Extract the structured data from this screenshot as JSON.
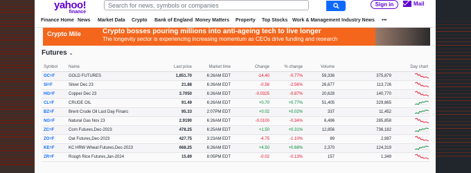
{
  "header": {
    "logo": "yahoo!",
    "logo_sub": "finance",
    "search_placeholder": "Search for news, symbols or companies",
    "signin": "Sign in",
    "mail": "Mail"
  },
  "nav": [
    "Finance Home",
    "News",
    "Market Data",
    "Crypto",
    "Bank of England",
    "Money Matters",
    "Property",
    "Top Stocks",
    "Work & Management",
    "Industry News",
    "•••"
  ],
  "banner": {
    "tag": "Crypto Mile",
    "headline": "Crypto bosses pouring millions into anti-ageing tech to live longer",
    "subline": "The longevity sector is experiencing increasing momentum as CEOs drive funding and research"
  },
  "section": {
    "title": "Futures"
  },
  "table": {
    "headers": [
      "Symbol",
      "Name",
      "Last price",
      "Market time",
      "Change",
      "% change",
      "Volume",
      "",
      "Day chart"
    ],
    "rows": [
      {
        "symbol": "GC=F",
        "name": "GOLD FUTURES",
        "price": "1,851.70",
        "time": "6:26AM EDT",
        "change": "-14.40",
        "pct": "-0.77%",
        "volume": "59,336",
        "oi": "375,879",
        "dir": "neg"
      },
      {
        "symbol": "SI=F",
        "name": "Silver Dec 23",
        "price": "21.88",
        "time": "6:26AM EDT",
        "change": "-0.58",
        "pct": "-2.56%",
        "volume": "26,677",
        "oi": "113,726",
        "dir": "neg"
      },
      {
        "symbol": "HG=F",
        "name": "Copper Dec 23",
        "price": "3.7050",
        "time": "6:26AM EDT",
        "change": "-0.0325",
        "pct": "-0.87%",
        "volume": "20,628",
        "oi": "140,770",
        "dir": "neg"
      },
      {
        "symbol": "CL=F",
        "name": "CRUDE OIL",
        "price": "91.49",
        "time": "6:26AM EDT",
        "change": "+0.70",
        "pct": "+0.77%",
        "volume": "51,405",
        "oi": "329,865",
        "dir": "pos"
      },
      {
        "symbol": "BZ=F",
        "name": "Brent Crude Oil Last Day Financ",
        "price": "95.33",
        "time": "2:07PM EDT",
        "change": "+0.02",
        "pct": "+0.02%",
        "volume": "337",
        "oi": "11,452",
        "dir": "pos"
      },
      {
        "symbol": "NG=F",
        "name": "Natural Gas Nov 23",
        "price": "2.9190",
        "time": "6:26AM EDT",
        "change": "-0.0100",
        "pct": "-0.34%",
        "volume": "6,496",
        "oi": "285,858",
        "dir": "neg"
      },
      {
        "symbol": "ZC=F",
        "name": "Corn Futures,Dec-2023",
        "price": "478.25",
        "time": "6:25AM EDT",
        "change": "+1.50",
        "pct": "+0.31%",
        "volume": "12,856",
        "oi": "736,182",
        "dir": "pos"
      },
      {
        "symbol": "ZO=F",
        "name": "Oat Futures,Dec-2023",
        "price": "427.75",
        "time": "3:23AM EDT",
        "change": "-4.75",
        "pct": "-1.10%",
        "volume": "89",
        "oi": "2,987",
        "dir": "neg"
      },
      {
        "symbol": "KE=F",
        "name": "KC HRW Wheat Futures,Dec-2023",
        "price": "668.25",
        "time": "6:26AM EDT",
        "change": "+4.50",
        "pct": "+0.68%",
        "volume": "2,370",
        "oi": "124,319",
        "dir": "pos"
      },
      {
        "symbol": "ZR=F",
        "name": "Rough Rice Futures,Jan-2024",
        "price": "15.89",
        "time": "8:05PM EDT",
        "change": "-0.02",
        "pct": "-0.13%",
        "volume": "157",
        "oi": "1,349",
        "dir": "neg"
      }
    ]
  },
  "colors": {
    "accent": "#6001d2",
    "link": "#0f69ff",
    "negative": "#eb0f29",
    "positive": "#008a35",
    "banner": "#f3661c"
  }
}
